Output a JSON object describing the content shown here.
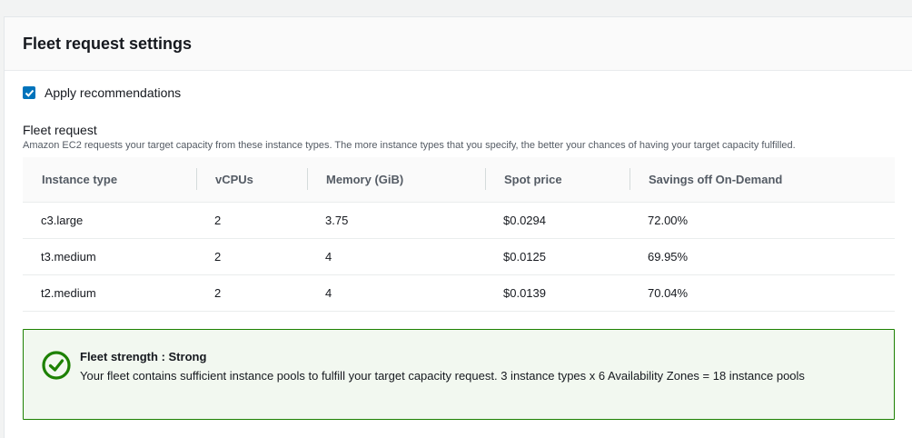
{
  "panel": {
    "title": "Fleet request settings"
  },
  "apply_recommendations": {
    "label": "Apply recommendations",
    "checked": true
  },
  "fleet_request": {
    "label": "Fleet request",
    "description": "Amazon EC2 requests your target capacity from these instance types. The more instance types that you specify, the better your chances of having your target capacity fulfilled."
  },
  "table": {
    "headers": [
      "Instance type",
      "vCPUs",
      "Memory (GiB)",
      "Spot price",
      "Savings off On-Demand"
    ],
    "rows": [
      [
        "c3.large",
        "2",
        "3.75",
        "$0.0294",
        "72.00%"
      ],
      [
        "t3.medium",
        "2",
        "4",
        "$0.0125",
        "69.95%"
      ],
      [
        "t2.medium",
        "2",
        "4",
        "$0.0139",
        "70.04%"
      ]
    ]
  },
  "alert": {
    "title": "Fleet strength : Strong",
    "body": "Your fleet contains sufficient instance pools to fulfill your target capacity request. 3 instance types x 6 Availability Zones = 18 instance pools",
    "icon": "check-circle-icon",
    "color": "#1d8102"
  },
  "colors": {
    "accent": "#0073bb",
    "success": "#1d8102",
    "success_bg": "#f2f8f0"
  }
}
